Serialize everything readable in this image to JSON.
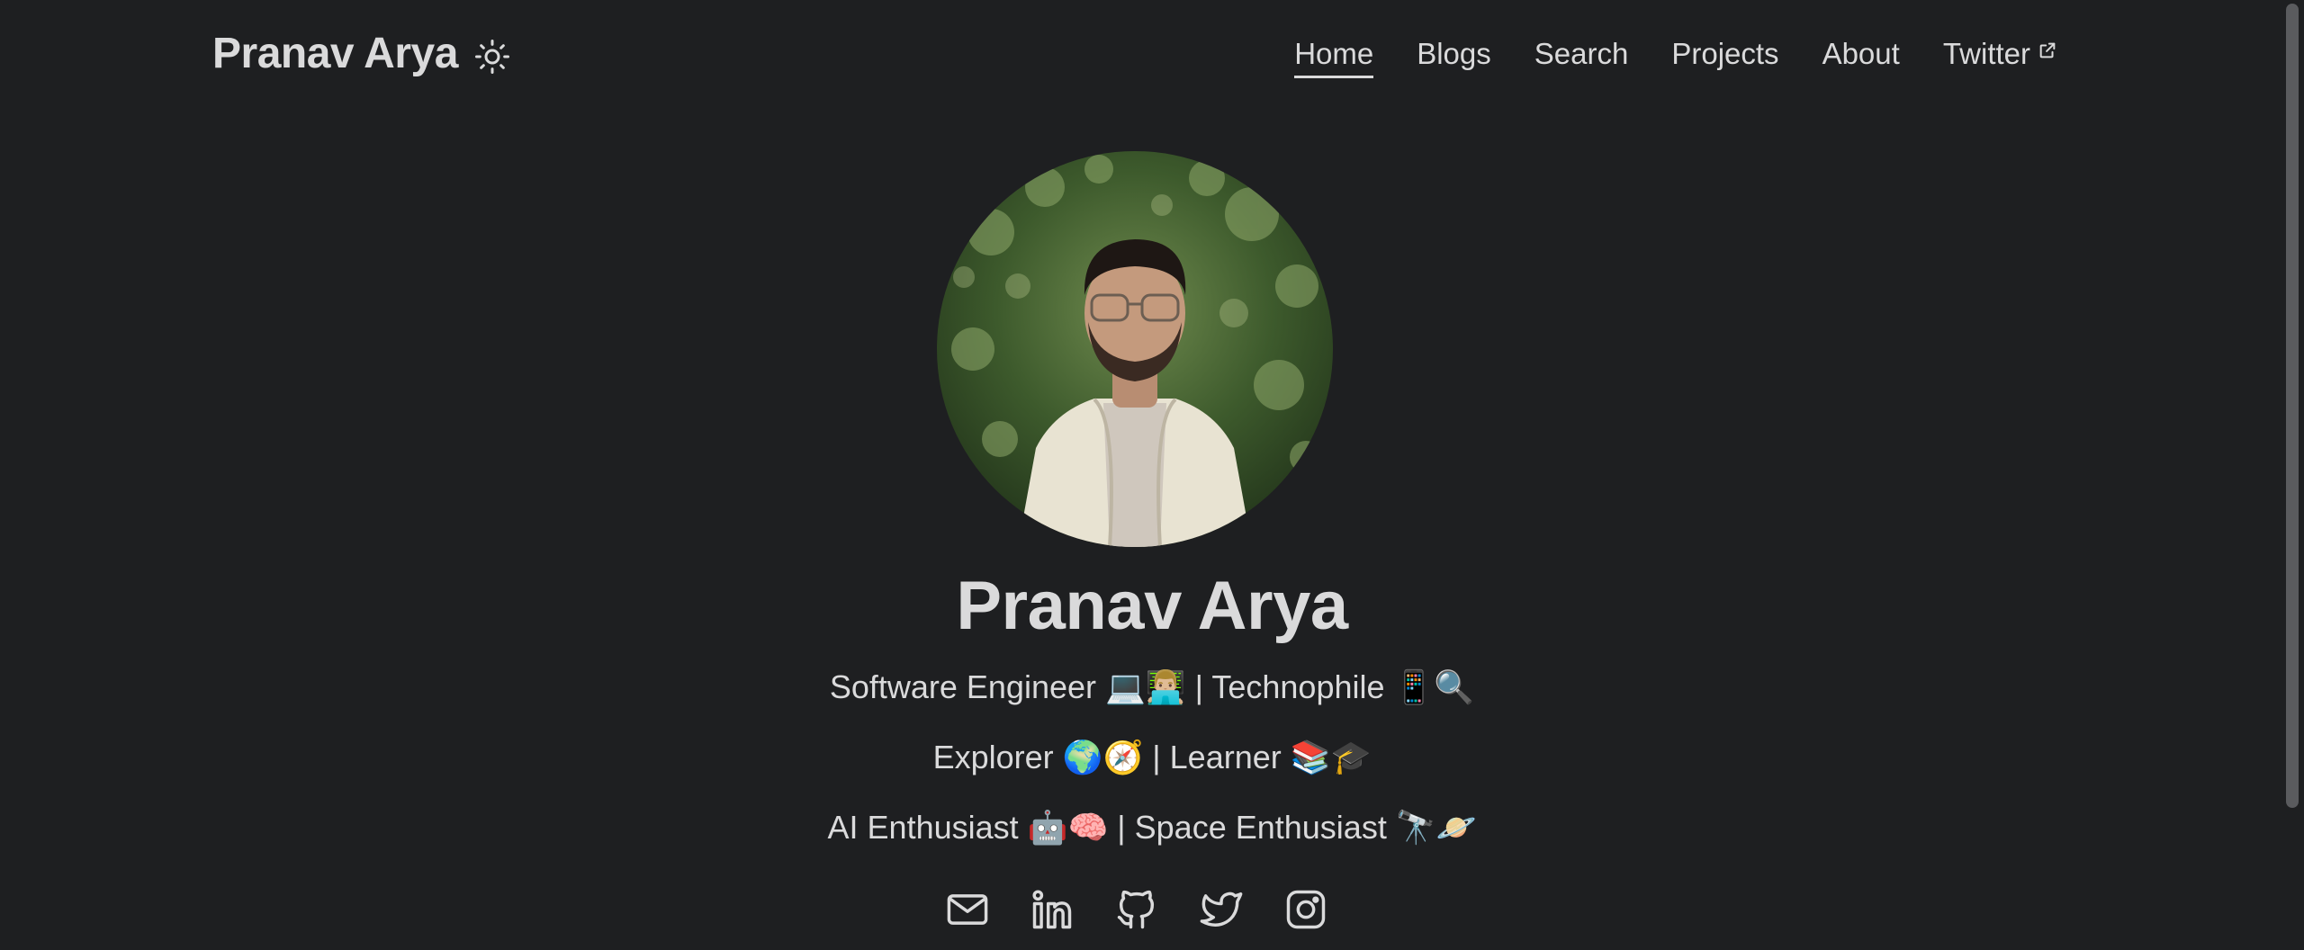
{
  "header": {
    "site_title": "Pranav Arya",
    "theme_toggle_icon": "sun-icon"
  },
  "nav": {
    "items": [
      {
        "label": "Home",
        "active": true
      },
      {
        "label": "Blogs"
      },
      {
        "label": "Search"
      },
      {
        "label": "Projects"
      },
      {
        "label": "About"
      },
      {
        "label": "Twitter",
        "external_icon": "external-link-icon"
      }
    ]
  },
  "profile": {
    "avatar_alt": "profile-photo",
    "name": "Pranav Arya",
    "taglines": [
      "Software Engineer 💻👨🏼‍💻 | Technophile 📱🔍",
      "Explorer 🌍🧭 | Learner 📚🎓",
      "AI Enthusiast 🤖🧠 | Space Enthusiast 🔭🪐"
    ]
  },
  "socials": [
    {
      "icon": "mail-icon"
    },
    {
      "icon": "linkedin-icon"
    },
    {
      "icon": "github-icon"
    },
    {
      "icon": "twitter-icon"
    },
    {
      "icon": "instagram-icon"
    }
  ],
  "colors": {
    "background": "#1e1f21",
    "text": "#dadadb"
  }
}
